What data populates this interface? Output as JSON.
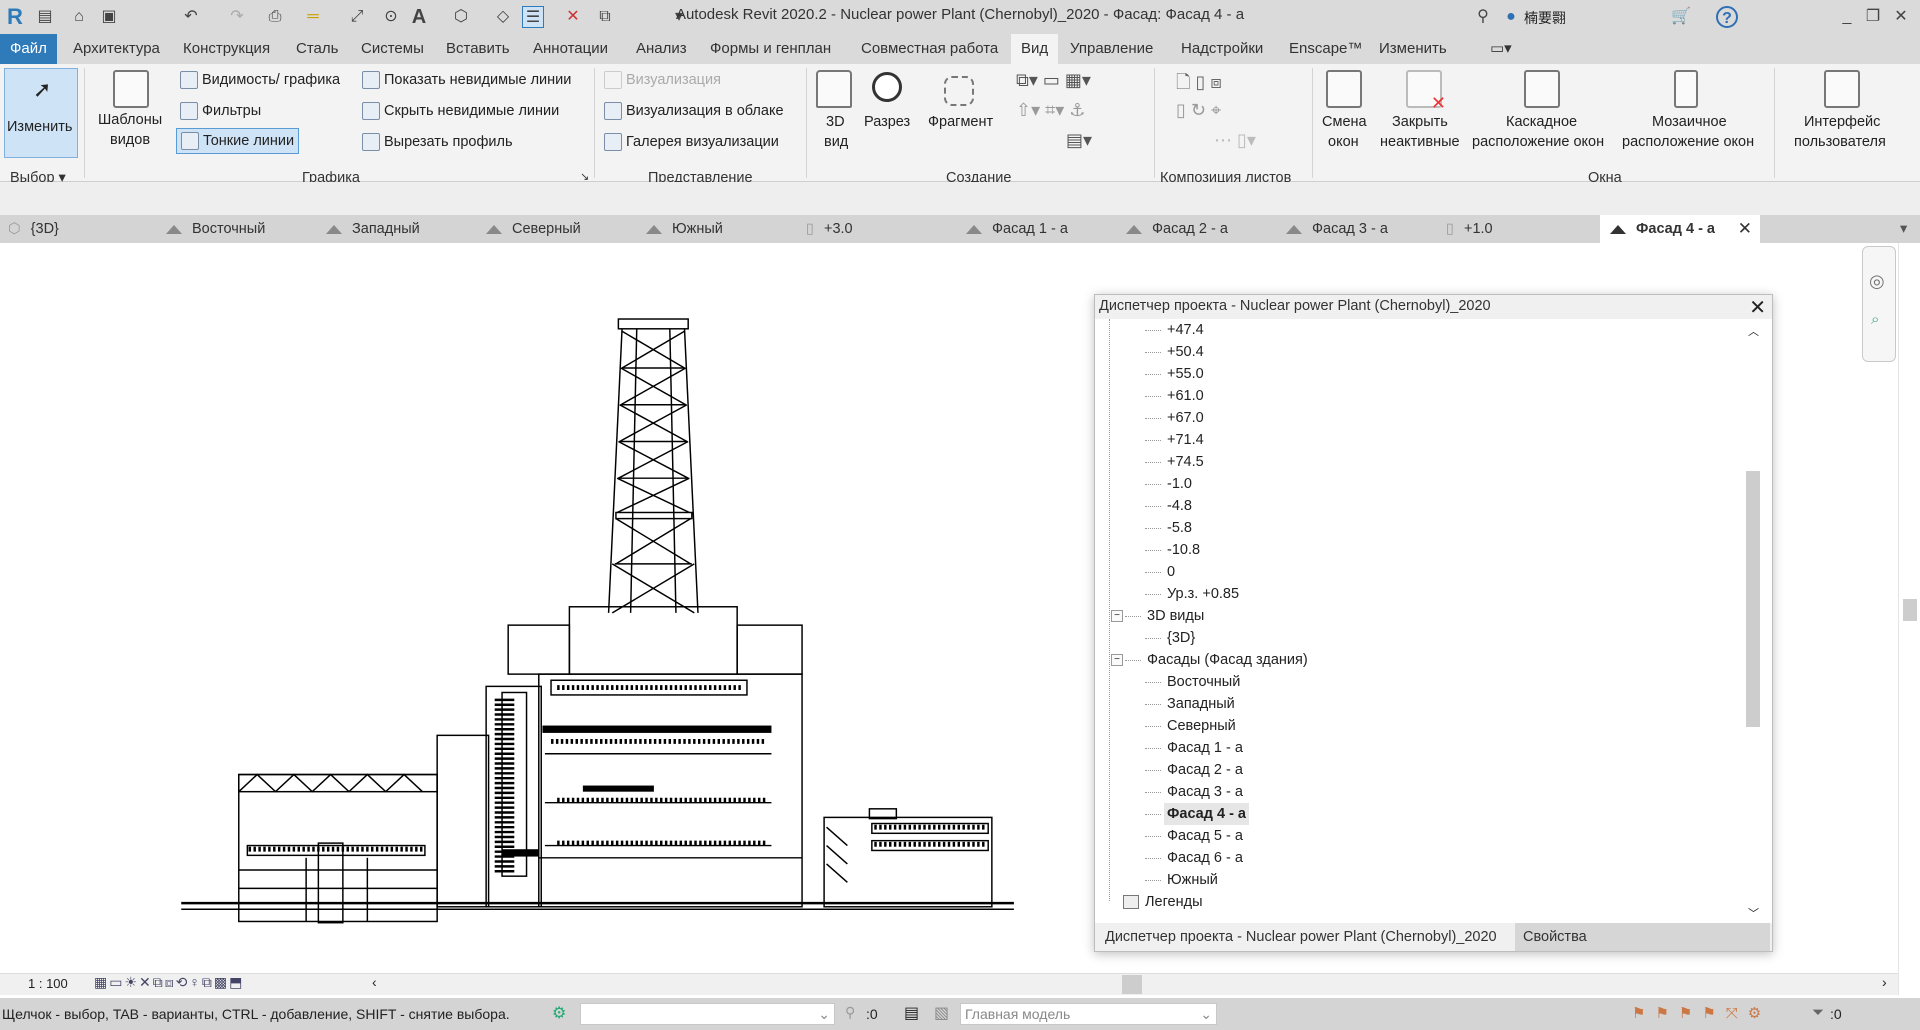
{
  "title": "Autodesk Revit 2020.2 - Nuclear power Plant (Chernobyl)_2020 - Фасад: Фасад 4 - а",
  "user": "楠要翾",
  "ribbon_tabs": [
    "Файл",
    "Архитектура",
    "Конструкция",
    "Сталь",
    "Системы",
    "Вставить",
    "Аннотации",
    "Анализ",
    "Формы и генплан",
    "Совместная работа",
    "Вид",
    "Управление",
    "Надстройки",
    "Enscape™",
    "Изменить"
  ],
  "active_tab": "Вид",
  "ribbon": {
    "modify": "Изменить",
    "select": "Выбор ▾",
    "templates1": "Шаблоны",
    "templates2": "видов",
    "visibility": "Видимость/ графика",
    "filters": "Фильтры",
    "thin_lines": "Тонкие линии",
    "show_hidden": "Показать невидимые линии",
    "hide_hidden": "Скрыть невидимые линии",
    "cut_profile": "Вырезать профиль",
    "graphics": "Графика",
    "render": "Визуализация",
    "render_cloud": "Визуализация  в облаке",
    "render_gallery": "Галерея  визуализации",
    "presentation": "Представление",
    "view3d_1": "3D",
    "view3d_2": "вид",
    "section": "Разрез",
    "callout": "Фрагмент",
    "create": "Создание",
    "sheet_comp": "Композиция листов",
    "switch1": "Смена",
    "switch2": "окон",
    "close1": "Закрыть",
    "close2": "неактивные",
    "cascade1": "Каскадное",
    "cascade2": "расположение окон",
    "tile1": "Мозаичное",
    "tile2": "расположение окон",
    "windows": "Окна",
    "ui1": "Интерфейс",
    "ui2": "пользователя"
  },
  "view_tabs": [
    "{3D}",
    "Восточный",
    "Западный",
    "Северный",
    "Южный",
    "+3.0",
    "Фасад 1 - а",
    "Фасад 2 - а",
    "Фасад 3 - а",
    "+1.0",
    "Фасад 4 - а"
  ],
  "project_browser": {
    "title": "Диспетчер проекта - Nuclear power Plant (Chernobyl)_2020",
    "levels": [
      "+47.4",
      "+50.4",
      "+55.0",
      "+61.0",
      "+67.0",
      "+71.4",
      "+74.5",
      "-1.0",
      "-4.8",
      "-5.8",
      "-10.8",
      "0",
      "Ур.з. +0.85"
    ],
    "views3d_group": "3D виды",
    "views3d": [
      "{3D}"
    ],
    "facades_group": "Фасады (Фасад здания)",
    "facades": [
      "Восточный",
      "Западный",
      "Северный",
      "Фасад 1 - а",
      "Фасад 2 - а",
      "Фасад 3 - а",
      "Фасад 4 - а",
      "Фасад 5 - а",
      "Фасад 6 - а",
      "Южный"
    ],
    "selected": "Фасад 4 - а",
    "legends": "Легенды",
    "footer_tabs": [
      "Диспетчер проекта - Nuclear power Plant (Chernobyl)_2020",
      "Свойства"
    ]
  },
  "view_bar": {
    "scale": "1 : 100"
  },
  "status": {
    "hint": "Щелчок - выбор, TAB - варианты, CTRL - добавление, SHIFT - снятие выбора.",
    "count1": ":0",
    "model": "Главная модель",
    "filter_count": ":0"
  },
  "colors": {
    "accent": "#2f7ab9"
  }
}
